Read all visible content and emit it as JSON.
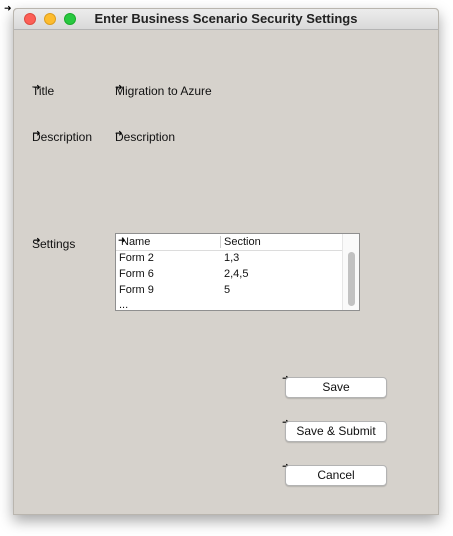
{
  "window": {
    "title": "Enter Business Scenario Security Settings"
  },
  "fields": {
    "title_label": "Title",
    "title_value": "Migration to Azure",
    "description_label": "Description",
    "description_value": "Description",
    "settings_label": "Settings"
  },
  "table": {
    "columns": [
      "Name",
      "Section"
    ],
    "rows": [
      [
        "Form 2",
        "1,3"
      ],
      [
        "Form 6",
        "2,4,5"
      ],
      [
        "Form 9",
        "5"
      ],
      [
        "...",
        ""
      ]
    ]
  },
  "buttons": {
    "save": "Save",
    "save_submit": "Save & Submit",
    "cancel": "Cancel"
  },
  "icons": {
    "marker": "pointer-arrow-icon",
    "traffic_lights": [
      "close-icon",
      "minimize-icon",
      "zoom-icon"
    ]
  },
  "colors": {
    "window_bg": "#d6d2cc",
    "close": "#fc5f57",
    "minimize": "#fdbc2e",
    "zoom": "#28c840"
  }
}
